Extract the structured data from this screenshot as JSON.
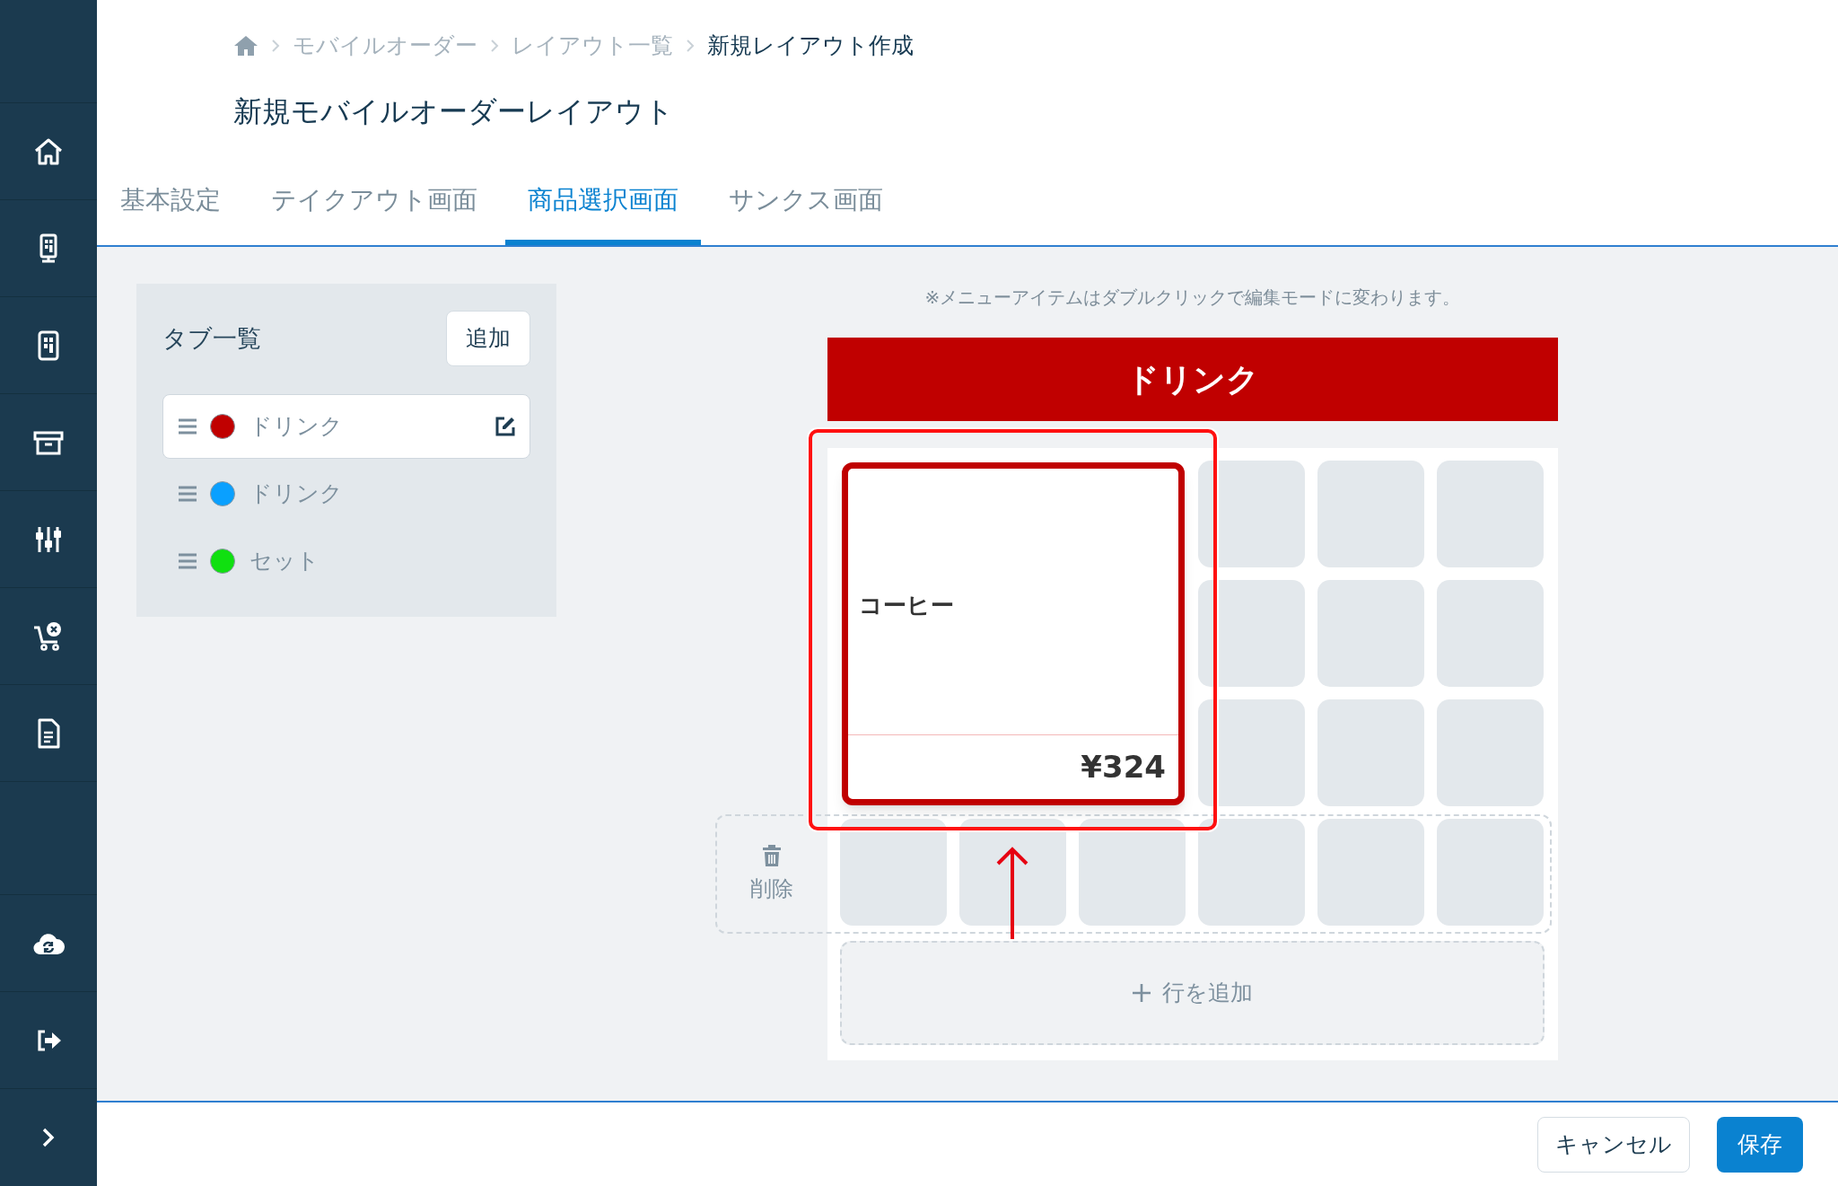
{
  "breadcrumb": [
    "モバイルオーダー",
    "レイアウト一覧",
    "新規レイアウト作成"
  ],
  "title": "新規モバイルオーダーレイアウト",
  "tabs": [
    {
      "label": "基本設定",
      "selected": false
    },
    {
      "label": "テイクアウト画面",
      "selected": false
    },
    {
      "label": "商品選択画面",
      "selected": true
    },
    {
      "label": "サンクス画面",
      "selected": false
    }
  ],
  "tab_list": {
    "title": "タブ一覧",
    "add_button": "追加",
    "items": [
      {
        "label": "ドリンク",
        "color": "#c00000",
        "selected": true
      },
      {
        "label": "ドリンク",
        "color": "#0aa0ff",
        "selected": false
      },
      {
        "label": "セット",
        "color": "#10e010",
        "selected": false
      }
    ]
  },
  "note": "※メニューアイテムはダブルクリックで編集モードに変わります。",
  "category_header": "ドリンク",
  "dragged_item": {
    "name": "コーヒー",
    "price": "¥324"
  },
  "delete_zone": "削除",
  "add_row": "行を追加",
  "footer": {
    "cancel": "キャンセル",
    "save": "保存"
  }
}
